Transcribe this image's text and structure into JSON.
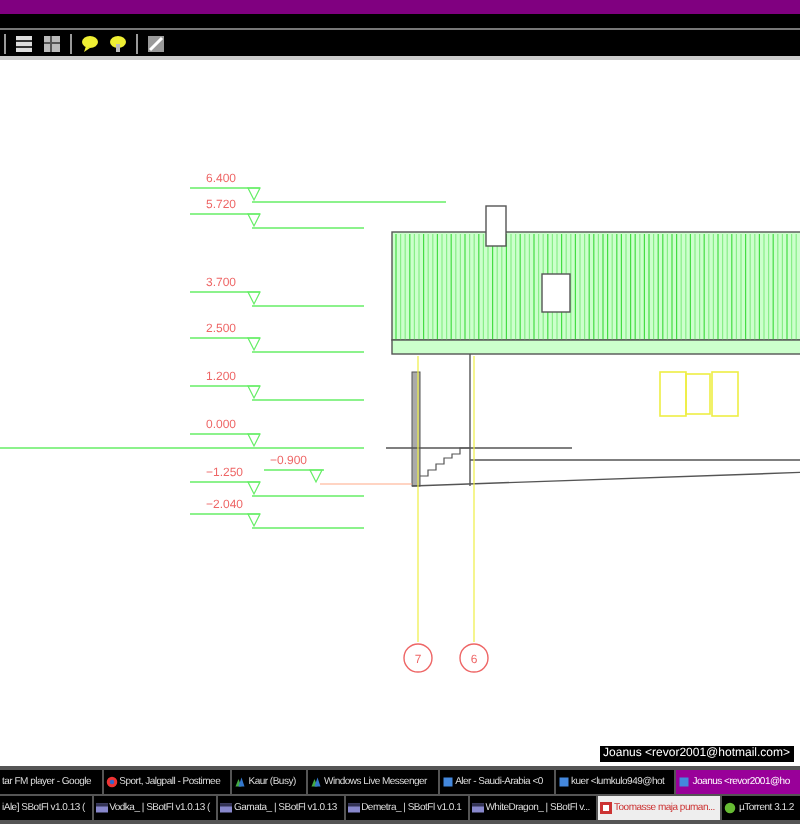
{
  "toolbar": {
    "icons": [
      {
        "kind": "window"
      },
      {
        "kind": "grid"
      },
      {
        "kind": "bubble"
      },
      {
        "kind": "bubble-pin"
      },
      {
        "kind": "expand"
      }
    ]
  },
  "drawing": {
    "levels": [
      {
        "label": "6.400",
        "kind": "long"
      },
      {
        "label": "5.720",
        "kind": "short"
      },
      {
        "label": "3.700",
        "kind": "short"
      },
      {
        "label": "2.500",
        "kind": "short"
      },
      {
        "label": "1.200",
        "kind": "short"
      },
      {
        "label": "0.000",
        "kind": "ground"
      },
      {
        "label": "−0.900",
        "kind": "side"
      },
      {
        "label": "−1.250",
        "kind": "short"
      },
      {
        "label": "−2.040",
        "kind": "short"
      }
    ],
    "grid_markers": [
      "7",
      "6"
    ]
  },
  "tooltip": "Joanus <revor2001@hotmail.com>",
  "taskbar": {
    "rows": [
      [
        {
          "label": "tar FM player - Google",
          "kind": "cut",
          "selected": false
        },
        {
          "label": "Sport, Jalgpall - Postimee",
          "kind": "browser",
          "selected": false
        },
        {
          "label": "Kaur (Busy)",
          "kind": "messenger",
          "selected": false
        },
        {
          "label": "Windows Live Messenger",
          "kind": "messenger",
          "selected": false
        },
        {
          "label": "Aler - Saudi-Arabia <0",
          "kind": "chat",
          "selected": false
        },
        {
          "label": "kuer <lumkulo949@hot",
          "kind": "chat",
          "selected": false
        },
        {
          "label": "Joanus <revor2001@ho",
          "kind": "chat",
          "selected": true
        }
      ],
      [
        {
          "label": "iAle] SBotFl v1.0.13 (",
          "kind": "cut",
          "selected": false
        },
        {
          "label": "Vodka_ | SBotFl v1.0.13 (",
          "kind": "window",
          "selected": false
        },
        {
          "label": "Gamata_ | SBotFl v1.0.13",
          "kind": "window",
          "selected": false
        },
        {
          "label": "Demetra_ | SBotFl v1.0.1",
          "kind": "window",
          "selected": false
        },
        {
          "label": "WhiteDragon_ | SBotFl v...",
          "kind": "window",
          "selected": false
        },
        {
          "label": "Toomasse maja puman...",
          "kind": "cad",
          "selected": true
        },
        {
          "label": "µTorrent 3.1.2",
          "kind": "torrent",
          "selected": false
        }
      ]
    ]
  }
}
